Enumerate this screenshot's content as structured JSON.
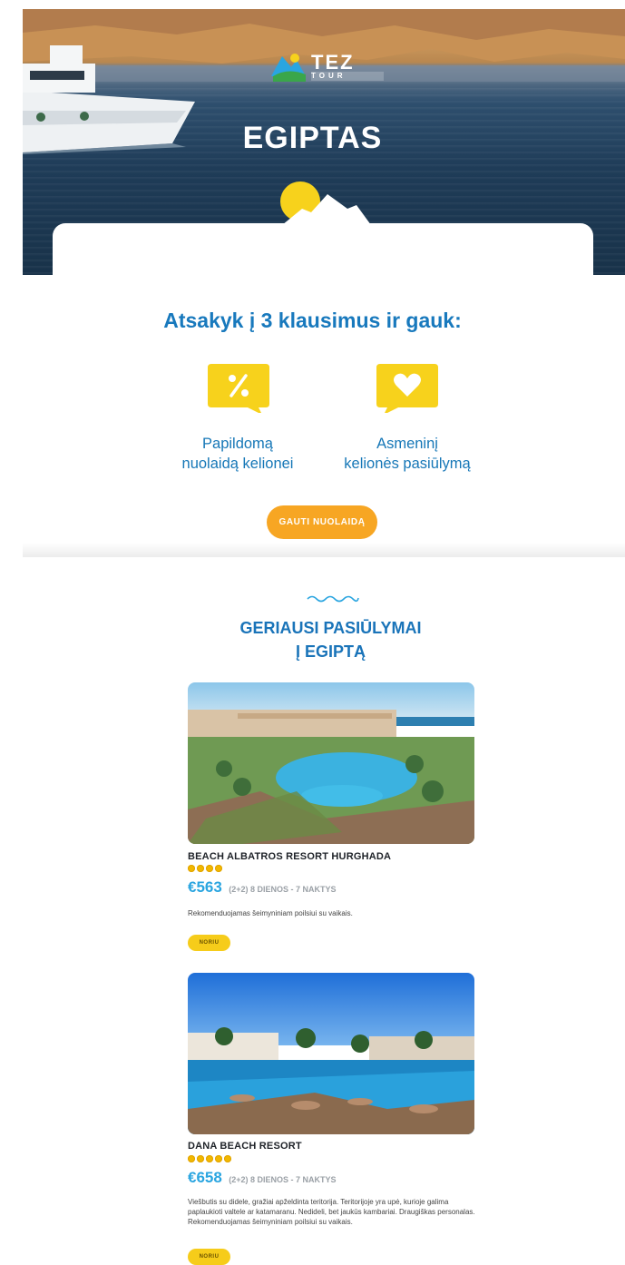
{
  "hero": {
    "title": "EGIPTAS",
    "logo_text_top": "TEZ",
    "logo_text_bottom": "TOUR"
  },
  "promo": {
    "title": "Atsakyk į 3 klausimus ir gauk:",
    "benefits": [
      {
        "icon": "percent-icon",
        "line1": "Papildomą",
        "line2": "nuolaidą kelionei"
      },
      {
        "icon": "heart-icon",
        "line1": "Asmeninį",
        "line2": "kelionės pasiūlymą"
      }
    ],
    "cta_label": "GAUTI NUOLAIDĄ"
  },
  "offers": {
    "title_line1": "GERIAUSI PASIŪLYMAI",
    "title_line2": "Į EGIPTĄ",
    "hotels": [
      {
        "name": "BEACH ALBATROS RESORT HURGHADA",
        "stars": 4,
        "price": "€563",
        "details": "(2+2) 8 DIENOS - 7 NAKTYS",
        "description": "Rekomenduojamas šeimyniniam poilsiui su vaikais.",
        "button": "NORIU"
      },
      {
        "name": "DANA BEACH RESORT",
        "stars": 5,
        "price": "€658",
        "details": "(2+2) 8 DIENOS - 7 NAKTYS",
        "description": "Viešbutis su didele, gražiai apželdinta teritorija. Teritorijoje yra upė, kurioje galima paplaukioti valtele ar katamaranu. Nedideli, bet jaukūs kambariai. Draugiškas personalas. Rekomenduojamas šeimyniniam poilsiui su vaikais.",
        "button": "NORIU"
      }
    ]
  },
  "colors": {
    "brand_blue": "#1879bd",
    "price_blue": "#2aa5e0",
    "yellow": "#f7d21c",
    "orange_cta": "#f7a623"
  }
}
